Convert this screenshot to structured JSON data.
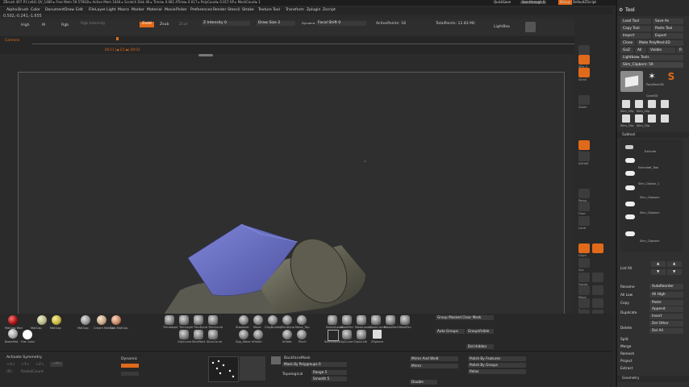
{
  "titlebar": {
    "text": "ZBrush 4R7 P3 (x64)    QV_1489    ▸ Free Mem 59.579GB ▸ Active Mem 1644 ▸ Scratch Disk 46 ▸ Timer▸ 0.081 ATime▸ 0.017 ▸ PolyCount▸ 0.017 KP ▸ MeshCount▸ 1",
    "quicksave": "QuickSave",
    "seethrough": "See-through  0",
    "menus": "Menus",
    "defaultscript": "DefaultZScript"
  },
  "menubar": {
    "items": [
      "Alpha",
      "Brush",
      "Color",
      "Document",
      "Draw",
      "Edit",
      "File",
      "Layer",
      "Light",
      "Macro",
      "Marker",
      "Material",
      "Movie",
      "Picker",
      "Preferences",
      "Render",
      "Stencil",
      "Stroke",
      "Texture",
      "Tool",
      "Transform",
      "Zplugin",
      "Zscript"
    ]
  },
  "coords": "0.502,-0.241,-1.655",
  "shelf": {
    "high": "High",
    "m": "M",
    "rgb": "Rgb",
    "rgb_intensity": "Rgb Intensity",
    "zadd": "Zadd",
    "zsub": "Zsub",
    "zcut": "Zcut",
    "z_intensity": "Z Intensity 0",
    "draw_size": "Draw Size 2",
    "dynamic": "Dynamic",
    "focal_shift": "Focal Shift 0",
    "active_points": "ActivePoints: 18",
    "total_points": "TotalPoints: 12.83 Mil",
    "lightbox": "LightBox"
  },
  "timeline": {
    "label": "Camera",
    "frame_label": "00:11 |◀ 1/1 ▶| 00:01"
  },
  "right_shelf": {
    "items": [
      "Bpr",
      "SPix 3",
      "Scroll",
      "Zoom",
      "Actual",
      "AAHalf",
      "Persp",
      "Floor",
      "Local",
      "LSym",
      "Xyz",
      "Frame",
      "Move",
      "Scale",
      "Rotate",
      "PolyF",
      "Transp",
      "Ghost",
      "Solo",
      "Xpose",
      "Dynamic"
    ]
  },
  "tool_panel": {
    "header": "Tool",
    "load_tool": "Load Tool",
    "save_as": "Save As",
    "copy_tool": "Copy Tool",
    "paste_tool": "Paste Tool",
    "import": "Import",
    "export": "Export",
    "clone": "Clone",
    "make_polymesh": "Make PolyMesh3D",
    "goz": "GoZ",
    "all": "All",
    "visible": "Visible",
    "r": "R",
    "lightbox_tools": "Lightbox▸ Tools",
    "current_tool": "Slim_Clipborn: 59",
    "thumb_labels": [
      "PolyMesh3D",
      "Cone3D",
      "Slim_Clip",
      "Slim_Clip",
      "Slim_Clip",
      "Slim_Clip"
    ],
    "subtool_header": "Subtool",
    "subtools": [
      "Extrude",
      "Extruded_Tool",
      "Slim_Clipbor_1",
      "Slim_Clipborn",
      "Slim_Clipborn",
      "Slim_Clipborn"
    ],
    "list_all": "List All",
    "rename": "Rename",
    "auto_reorder": "AutoReorder",
    "all_low": "All Low",
    "all_high": "All High",
    "copy": "Copy",
    "paste": "Paste",
    "duplicate": "Duplicate",
    "append": "Append",
    "insert": "Insert",
    "delete": "Delete",
    "del_other": "Del Other",
    "del_all": "Del All",
    "split": "Split",
    "merge": "Merge",
    "remesh": "Remesh",
    "project": "Project",
    "extract": "Extract",
    "geometry": "Geometry"
  },
  "bottom": {
    "materials": [
      "MatCap Red",
      "MatCap",
      "MatCap",
      "MatCap",
      "Cream MatCap",
      "Skin MatCap"
    ],
    "basic_mat": "BasicMat",
    "flat_color": "Flat Color",
    "brushes_row1": [
      "TrimAdapt",
      "TrimLayer",
      "TrimDyna",
      "TrimCurve"
    ],
    "brushes_row2": [
      "ClipCurve",
      "SliceRect",
      "SliceCurve"
    ],
    "brushes_row3": [
      "Standard",
      "Move",
      "ClayBuildup",
      "TrimDyna",
      "Move_Top"
    ],
    "brushes_row4": [
      "Zpp_Move",
      "hPolish",
      "Inflate",
      "Pinch"
    ],
    "brushes_row5": [
      "SelectLasso",
      "MaskPen",
      "MaskLasso",
      "MaskCurve",
      "MaskRect",
      "MaskPen"
    ],
    "brushes_row6": [
      "SelectRect",
      "ClipCurve",
      "ClipCircle",
      "ZSphere"
    ],
    "activate_symmetry": "Activate Symmetry",
    "x": ">X<",
    "y": ">Y<",
    "z": ">Z<",
    "m": ">M<",
    "radial_count": "RadialCount",
    "dynamic": "Dynamic",
    "group_visible": "Group Masked Clear Mask",
    "auto_groups": "Auto Groups",
    "group_visible_btn": "GroupVisible",
    "del_hidden": "Del Hidden",
    "backface_mask": "BackfaceMask",
    "mask_by_polygroups": "Mask By Polygroups 0",
    "topological": "Topological",
    "range": "Range 5",
    "smooth": "Smooth 5",
    "mirror_weld": "Mirror And Weld",
    "mirror": "Mirror",
    "double": "Double",
    "polish_features": "Polish By Features",
    "polish_groups": "Polish By Groups",
    "relax": "Relax"
  },
  "colors": {
    "accent": "#e06a1a",
    "panel": "#303030",
    "viewport": "#2f2f2f",
    "mesh_blue": "#6a70c8",
    "mesh_gray": "#6e6d5c"
  }
}
